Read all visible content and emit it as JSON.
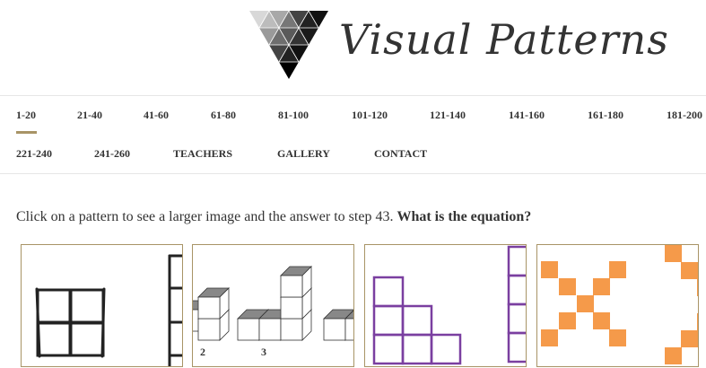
{
  "logo": {
    "text": "Visual Patterns",
    "icon": "triangle-logo-icon"
  },
  "nav": {
    "row1": [
      "1-20",
      "21-40",
      "41-60",
      "61-80",
      "81-100",
      "101-120",
      "121-140",
      "141-160",
      "161-180",
      "181-200"
    ],
    "row2": [
      "221-240",
      "241-260",
      "TEACHERS",
      "GALLERY",
      "CONTACT"
    ],
    "active": "1-20"
  },
  "intro": {
    "text": "Click on a pattern to see a larger image and the answer to step 43. ",
    "bold": "What is the equation?"
  },
  "tiles": [
    {
      "name": "pattern-tile-1",
      "labels": []
    },
    {
      "name": "pattern-tile-2",
      "labels": [
        "2",
        "3"
      ]
    },
    {
      "name": "pattern-tile-3",
      "labels": []
    },
    {
      "name": "pattern-tile-4",
      "labels": []
    }
  ],
  "colors": {
    "accent": "#a89466",
    "purple": "#7a3fa0",
    "orange": "#f59a4a"
  }
}
